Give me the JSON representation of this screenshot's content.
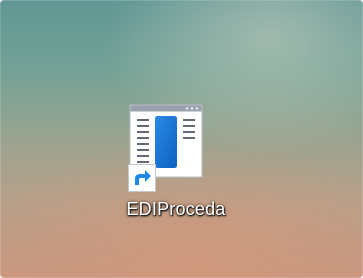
{
  "desktop": {
    "shortcut": {
      "label": "EDIProceda",
      "icon": "app-window-icon",
      "overlay_icon": "shortcut-arrow-icon",
      "colors": {
        "icon_accent": "#1976d2",
        "arrow": "#1e88e5"
      }
    }
  }
}
